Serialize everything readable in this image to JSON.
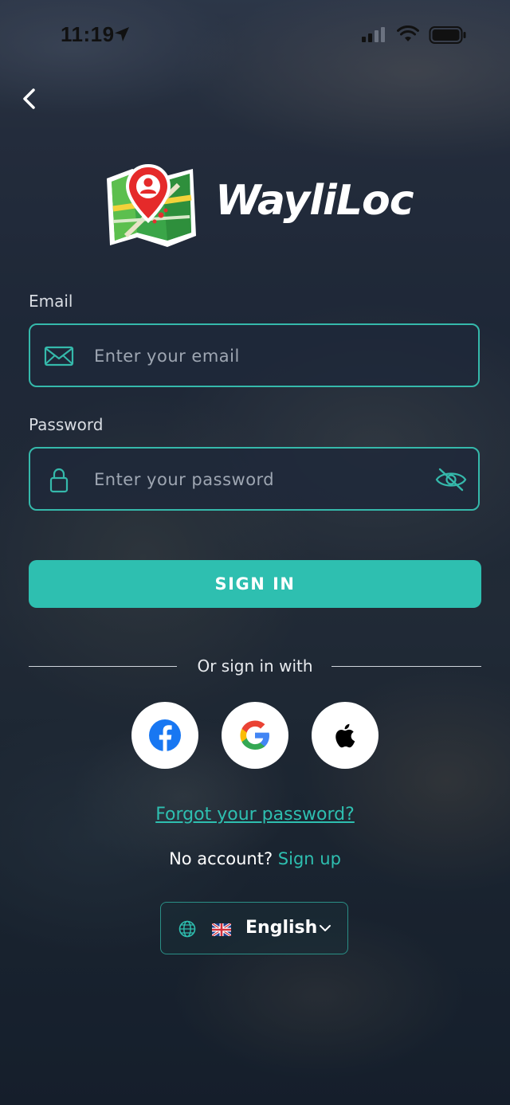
{
  "status_bar": {
    "time": "11:19"
  },
  "brand": {
    "name": "WayliLoc"
  },
  "form": {
    "email_label": "Email",
    "email_placeholder": "Enter your email",
    "password_label": "Password",
    "password_placeholder": "Enter your password",
    "signin_label": "SIGN IN"
  },
  "social": {
    "divider_text": "Or sign in with",
    "providers": [
      "facebook",
      "google",
      "apple"
    ]
  },
  "links": {
    "forgot_password": "Forgot your password?",
    "no_account": "No account?",
    "sign_up": "Sign up"
  },
  "language": {
    "selected": "English",
    "flag": "uk-flag-icon"
  },
  "colors": {
    "accent": "#2ebfb0",
    "field_border": "#35b9ab",
    "background": "#1a2333"
  }
}
